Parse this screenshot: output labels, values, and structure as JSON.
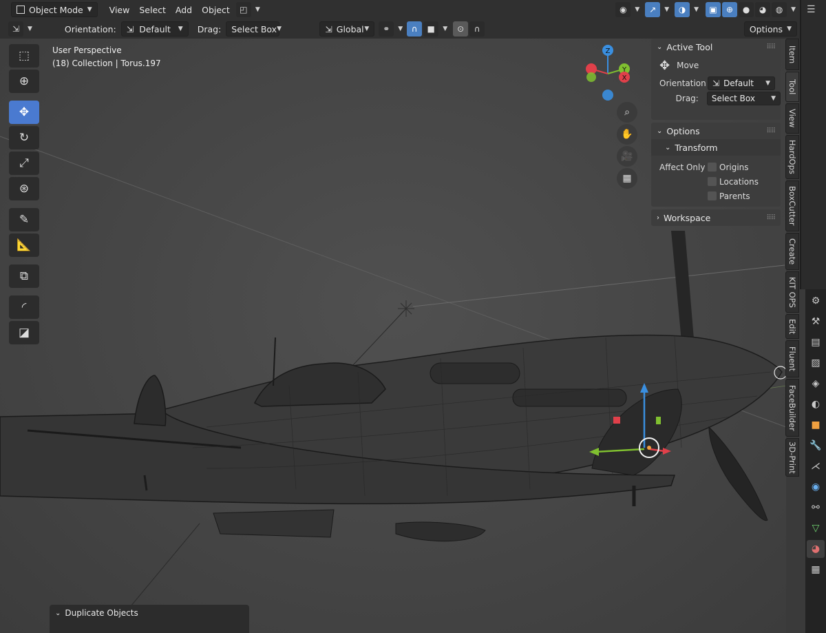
{
  "header": {
    "mode": "Object Mode",
    "menus": [
      "View",
      "Select",
      "Add",
      "Object"
    ],
    "orientation_label": "Orientation:",
    "orientation_value": "Default",
    "drag_label": "Drag:",
    "drag_value": "Select Box",
    "transform_space": "Global",
    "options_label": "Options"
  },
  "viewport": {
    "view_name": "User Perspective",
    "collection": "(18) Collection | Torus.197"
  },
  "gizmo": {
    "z": "Z",
    "x": "X",
    "y": "Y"
  },
  "npanel": {
    "active_tool": {
      "title": "Active Tool",
      "tool": "Move",
      "orientation_label": "Orientation",
      "orientation_value": "Default",
      "drag_label": "Drag:",
      "drag_value": "Select Box"
    },
    "options": {
      "title": "Options",
      "transform": "Transform",
      "affect_only": "Affect Only",
      "origins": "Origins",
      "locations": "Locations",
      "parents": "Parents"
    },
    "workspace": "Workspace"
  },
  "tabs": [
    "Item",
    "Tool",
    "View",
    "HardOps",
    "BoxCutter",
    "Create",
    "KIT OPS",
    "Edit",
    "Fluent",
    "FaceBuilder",
    "3D-Print"
  ],
  "operator_panel": {
    "title": "Duplicate Objects"
  },
  "colors": {
    "accent": "#4a7ad0",
    "x_axis": "#e0404a",
    "y_axis": "#80c030",
    "z_axis": "#3a8fe0"
  }
}
